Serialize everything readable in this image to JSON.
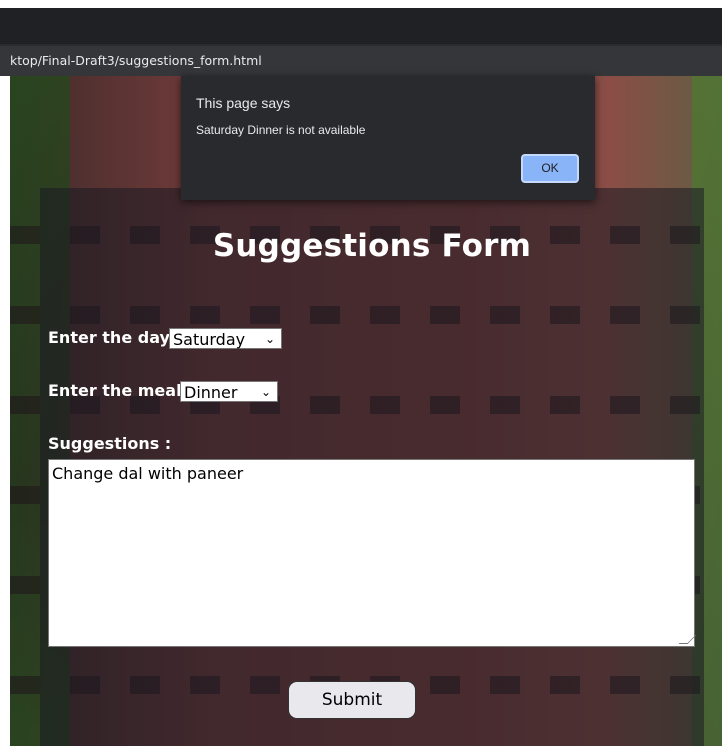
{
  "browser": {
    "url": "ktop/Final-Draft3/suggestions_form.html"
  },
  "form": {
    "title": "Suggestions Form",
    "day_label": "Enter the day :",
    "day_value": "Saturday",
    "meal_label": "Enter the meal :",
    "meal_value": "Dinner",
    "suggestions_label": "Suggestions :",
    "suggestions_value": "Change dal with paneer",
    "submit_label": "Submit"
  },
  "dialog": {
    "title": "This page says",
    "message": "Saturday Dinner is not available",
    "ok_label": "OK"
  },
  "icons": {
    "dropdown": "chevron-down-icon",
    "resize": "resize-grip-icon"
  },
  "colors": {
    "dialog_bg": "#292a2d",
    "ok_button": "#8ab4f8",
    "browser_bar": "#202124"
  }
}
